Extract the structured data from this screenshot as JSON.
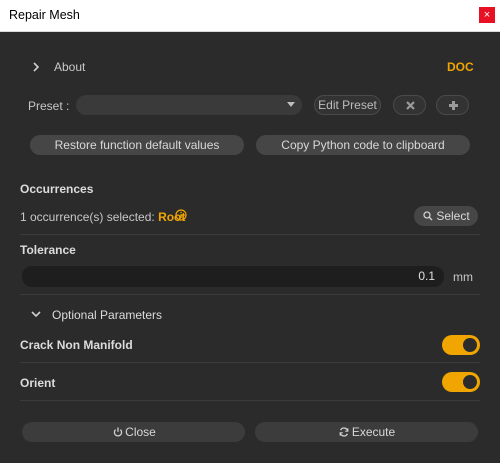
{
  "window": {
    "title": "Repair Mesh",
    "close_glyph": "×"
  },
  "about": {
    "chevron": "›",
    "label": "About",
    "doc_label": "DOC"
  },
  "preset": {
    "label": "Preset :",
    "selected_value": "",
    "edit_label": "Edit Preset",
    "delete_icon": "delete-preset-icon",
    "add_icon": "add-preset-icon"
  },
  "actions": {
    "restore_label": "Restore function default values",
    "copy_label": "Copy Python code to clipboard"
  },
  "occurrences": {
    "heading": "Occurrences",
    "selected_text": "1 occurrence(s) selected: ",
    "root_label": "Root",
    "select_label": "Select"
  },
  "tolerance": {
    "heading": "Tolerance",
    "value": "0.1",
    "unit": "mm"
  },
  "optional": {
    "heading": "Optional Parameters"
  },
  "params": [
    {
      "label": "Crack Non Manifold",
      "enabled": true
    },
    {
      "label": "Orient",
      "enabled": true
    }
  ],
  "footer": {
    "close_label": "Close",
    "execute_label": "Execute"
  },
  "colors": {
    "accent": "#f0a500",
    "background": "#2b2b2b",
    "button": "#464646"
  }
}
